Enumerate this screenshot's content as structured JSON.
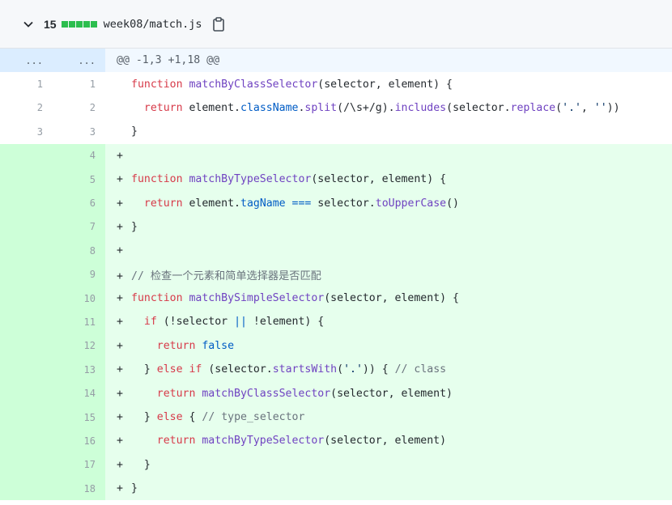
{
  "file": {
    "changes": "15",
    "path": "week08/match.js"
  },
  "hunk": {
    "old_marker": "...",
    "new_marker": "...",
    "header": "@@ -1,3 +1,18 @@"
  },
  "lines": [
    {
      "old": "1",
      "new": "1",
      "type": "ctx"
    },
    {
      "old": "2",
      "new": "2",
      "type": "ctx"
    },
    {
      "old": "3",
      "new": "3",
      "type": "ctx"
    },
    {
      "old": "",
      "new": "4",
      "type": "add"
    },
    {
      "old": "",
      "new": "5",
      "type": "add"
    },
    {
      "old": "",
      "new": "6",
      "type": "add"
    },
    {
      "old": "",
      "new": "7",
      "type": "add"
    },
    {
      "old": "",
      "new": "8",
      "type": "add"
    },
    {
      "old": "",
      "new": "9",
      "type": "add"
    },
    {
      "old": "",
      "new": "10",
      "type": "add"
    },
    {
      "old": "",
      "new": "11",
      "type": "add"
    },
    {
      "old": "",
      "new": "12",
      "type": "add"
    },
    {
      "old": "",
      "new": "13",
      "type": "add"
    },
    {
      "old": "",
      "new": "14",
      "type": "add"
    },
    {
      "old": "",
      "new": "15",
      "type": "add"
    },
    {
      "old": "",
      "new": "16",
      "type": "add"
    },
    {
      "old": "",
      "new": "17",
      "type": "add"
    },
    {
      "old": "",
      "new": "18",
      "type": "add"
    }
  ],
  "tokens": {
    "l1": {
      "a": "function ",
      "b": "matchByClassSelector",
      "c": "(selector, element) {"
    },
    "l2": {
      "a": "return ",
      "b": "element.",
      "c": "className",
      "d": ".",
      "e": "split",
      "f": "(/\\s+/g).",
      "g": "includes",
      "h": "(selector.",
      "i": "replace",
      "j": "(",
      "k": "'.'",
      "l": ", ",
      "m": "''",
      "n": "))"
    },
    "l3": {
      "a": "}"
    },
    "l4": {
      "p": "+"
    },
    "l5": {
      "p": "+",
      "a": "function ",
      "b": "matchByTypeSelector",
      "c": "(selector, element) {"
    },
    "l6": {
      "p": "+",
      "a": "return ",
      "b": "element.",
      "c": "tagName",
      "d": " === ",
      "e": "selector.",
      "f": "toUpperCase",
      "g": "()"
    },
    "l7": {
      "p": "+",
      "a": "}"
    },
    "l8": {
      "p": "+"
    },
    "l9": {
      "p": "+",
      "a": "// 检查一个元素和简单选择器是否匹配"
    },
    "l10": {
      "p": "+",
      "a": "function ",
      "b": "matchBySimpleSelector",
      "c": "(selector, element) {"
    },
    "l11": {
      "p": "+",
      "a": "if ",
      "b": "(!selector ",
      "c": "||",
      "d": " !element) {"
    },
    "l12": {
      "p": "+",
      "a": "return ",
      "b": "false"
    },
    "l13": {
      "p": "+",
      "a": "} ",
      "b": "else if ",
      "c": "(selector.",
      "d": "startsWith",
      "e": "(",
      "f": "'.'",
      "g": ")) { ",
      "h": "// class"
    },
    "l14": {
      "p": "+",
      "a": "return ",
      "b": "matchByClassSelector",
      "c": "(selector, element)"
    },
    "l15": {
      "p": "+",
      "a": "} ",
      "b": "else ",
      "c": "{ ",
      "d": "// type_selector"
    },
    "l16": {
      "p": "+",
      "a": "return ",
      "b": "matchByTypeSelector",
      "c": "(selector, element)"
    },
    "l17": {
      "p": "+",
      "a": "}"
    },
    "l18": {
      "p": "+",
      "a": "}"
    }
  },
  "colors": {
    "added_bg": "#e6ffed",
    "added_gutter": "#cdffd8",
    "hunk_bg": "#f1f8ff",
    "diffstat": "#2cbe4e"
  },
  "icons": {
    "collapse": "chevron-down-icon",
    "copy": "clipboard-icon"
  }
}
